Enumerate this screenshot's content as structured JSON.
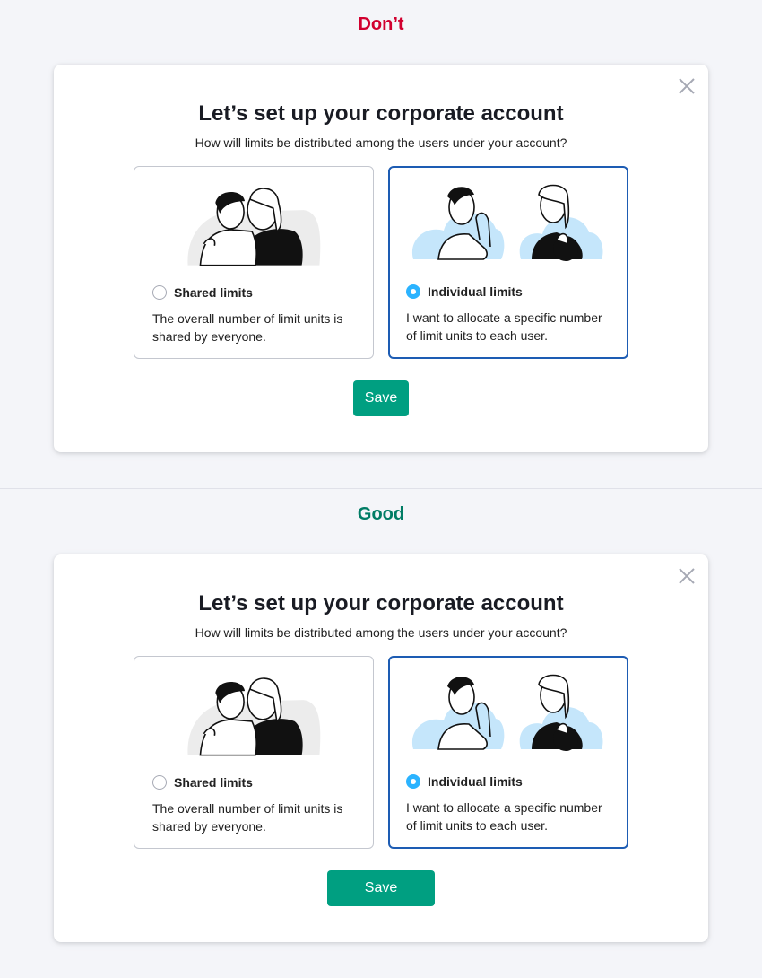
{
  "sections": {
    "dont": {
      "label": "Don’t"
    },
    "good": {
      "label": "Good"
    }
  },
  "modal": {
    "title": "Let’s set up your corporate account",
    "subtitle": "How will limits be distributed among the users under your account?",
    "options": [
      {
        "label": "Shared limits",
        "description": "The overall number of limit units is shared by everyone.",
        "selected": false
      },
      {
        "label": "Individual limits",
        "description": "I want to allocate a specific number of limit units to each user.",
        "selected": true
      }
    ],
    "save_label": "Save",
    "close_icon": "close-icon"
  },
  "colors": {
    "dont_label": "#d1002f",
    "good_label": "#007c65",
    "save_button": "#009f81",
    "selected_border": "#1d5cb3",
    "radio_selected": "#2bb3ff",
    "illustration_blue": "#c5e6fb"
  }
}
